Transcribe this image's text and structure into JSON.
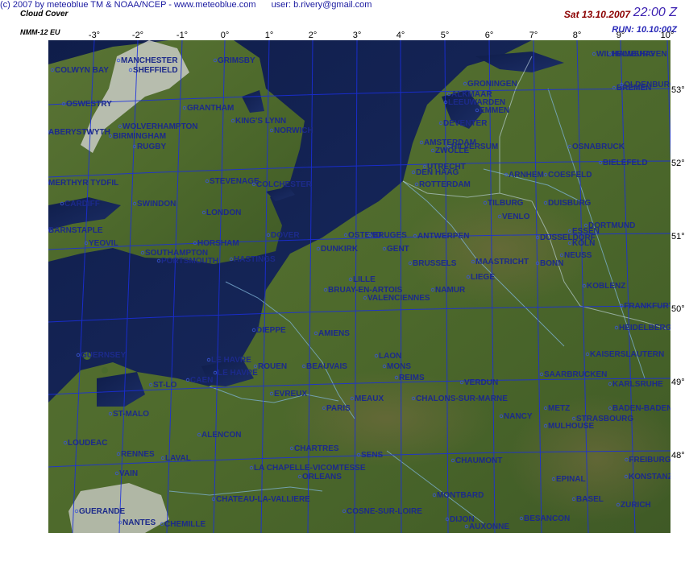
{
  "header": {
    "title": "Cloud Cover",
    "model": "NMM-12 EU",
    "date": "Sat 13.10.2007",
    "time": "22:00 Z",
    "run": "RUN: 10.10:00Z"
  },
  "footer": {
    "copyright": "(c) 2007 by meteoblue TM & NOAA/NCEP - www.meteoblue.com",
    "user": "user: b.rivery@gmail.com"
  },
  "grid": {
    "lon_labels": [
      "-3°",
      "-2°",
      "-1°",
      "0°",
      "1°",
      "2°",
      "3°",
      "4°",
      "5°",
      "6°",
      "7°",
      "8°",
      "9°",
      "10°"
    ],
    "lat_labels": [
      "53°",
      "52°",
      "51°",
      "50°",
      "49°",
      "48°"
    ]
  },
  "colors": {
    "sea": "#17265a",
    "land": "#4f6a2e",
    "grid": "#1a2ee0",
    "city_text": "#1c2a8a",
    "cloud": "#c9cbc4"
  },
  "cities": [
    "MANCHESTER",
    "SHEFFIELD",
    "GRIMSBY",
    "COLWYN BAY",
    "OSWESTRY",
    "GRANTHAM",
    "KING'S LYNN",
    "WOLVERHAMPTON",
    "BIRMINGHAM",
    "NORWICH",
    "ABERYSTWYTH",
    "RUGBY",
    "MERTHYR TYDFIL",
    "STEVENAGE",
    "COLCHESTER",
    "CARDIFF",
    "SWINDON",
    "LONDON",
    "BARNSTAPLE",
    "YEOVIL",
    "HORSHAM",
    "SOUTHAMPTON",
    "PORTSMOUTH",
    "HASTINGS",
    "DOVER",
    "DUNKIRK",
    "OSTEND",
    "BRUGES",
    "GENT",
    "ANTWERPEN",
    "BRUSSELS",
    "LILLE",
    "BRUAY-EN-ARTOIS",
    "VALENCIENNES",
    "NAMUR",
    "LIEGE",
    "MAASTRICHT",
    "DIEPPE",
    "AMIENS",
    "LE HAVRE",
    "ROUEN",
    "LE HAVRE",
    "BEAUVAIS",
    "LAON",
    "REIMS",
    "GUERNSEY",
    "ST-LO",
    "CAEN",
    "EVREUX",
    "PARIS",
    "MEAUX",
    "CHALONS-SUR-MARNE",
    "VERDUN",
    "METZ",
    "NANCY",
    "ST-MALO",
    "ALENCON",
    "RENNES",
    "LAVAL",
    "LOUDEAC",
    "VAIN",
    "CHARTRES",
    "SENS",
    "CHAUMONT",
    "GUERANDE",
    "NANTES",
    "CHEMILLE",
    "LA CHAPELLE-VICOMTESSE",
    "ORLEANS",
    "CHATEAU-LA-VALLIERE",
    "COSNE-SUR-LOIRE",
    "MONTBARD",
    "DIJON",
    "AUXONNE",
    "BESANCON",
    "EPINAL",
    "MULHOUSE",
    "BASEL",
    "ZURICH",
    "KONSTANZ",
    "FREIBURG",
    "STRASBOURG",
    "BADEN-BADEN",
    "KAISERSLAUTERN",
    "SAARBRUCKEN",
    "KARLSRUHE",
    "HEIDELBERG",
    "FRANKFURT",
    "KOBLENZ",
    "BONN",
    "KOLN",
    "DUSSELDORF",
    "ESSEN",
    "DORTMUND",
    "DUISBURG",
    "VENLO",
    "TILBURG",
    "ARNHEM",
    "ROTTERDAM",
    "DEN HAAG",
    "UTRECHT",
    "HILVERSUM",
    "AMSTERDAM",
    "LEEUWARDEN",
    "GRONINGEN",
    "EMMEN",
    "DEVENTER",
    "OSNABRUCK",
    "BIELEFELD",
    "BREMEN",
    "OLDENBURG",
    "WILHELMSHAVEN",
    "HAMBURG",
    "MONS",
    "NEUSS",
    "COESFELD",
    "ZWOLLE",
    "ALKMAAR"
  ]
}
